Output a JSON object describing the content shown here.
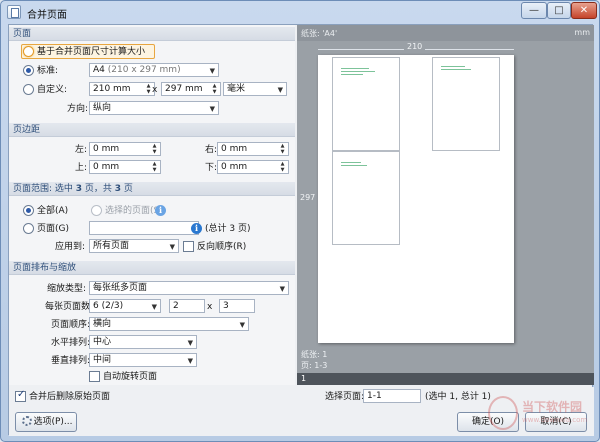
{
  "window": {
    "title": "合并页面",
    "minimize": "—",
    "maximize": "□",
    "close": "✕"
  },
  "page": {
    "section_title": "页面",
    "radio_merge_size": "基于合并页面尺寸计算大小",
    "radio_standard": "标准:",
    "standard_value": "A4",
    "standard_dims": "(210 x 297 mm)",
    "radio_custom": "自定义:",
    "custom_width": "210 mm",
    "custom_x": "x",
    "custom_height": "297 mm",
    "unit": "毫米",
    "orientation_label": "方向:",
    "orientation_value": "纵向"
  },
  "margins": {
    "section_title": "页边距",
    "left_label": "左:",
    "left_value": "0 mm",
    "right_label": "右:",
    "right_value": "0 mm",
    "top_label": "上:",
    "top_value": "0 mm",
    "bottom_label": "下:",
    "bottom_value": "0 mm"
  },
  "range": {
    "section_title_prefix": "页面范围: 选中 ",
    "selected_count": "3",
    "section_title_middle": " 页，共 ",
    "total_count": "3",
    "section_title_suffix": " 页",
    "radio_all": "全部(A)",
    "radio_selected": "选择的页面(S)",
    "radio_pages": "页面(G)",
    "pages_value": "",
    "total_note": "(总计 3 页)",
    "apply_label": "应用到:",
    "apply_value": "所有页面",
    "reverse_label": "反向顺序(R)",
    "info_glyph": "i"
  },
  "layout": {
    "section_title": "页面排布与缩放",
    "scale_type_label": "缩放类型:",
    "scale_type_value": "每张纸多页面",
    "pages_per_sheet_label": "每张页面数:",
    "pages_per_sheet_value": "6 (2/3)",
    "cols_value": "2",
    "times": "x",
    "rows_value": "3",
    "order_label": "页面顺序:",
    "order_value": "横向",
    "h_align_label": "水平排列:",
    "h_align_value": "中心",
    "v_align_label": "垂直排列:",
    "v_align_value": "中间",
    "auto_rotate_label": "自动旋转页面"
  },
  "bottom": {
    "delete_original_label": "合并后删除原始页面",
    "options_button": "选项(P)...",
    "select_pages_label": "选择页面:",
    "select_pages_value": "1-1",
    "select_note": "(选中 1, 总计 1)",
    "ok_button": "确定(O)",
    "cancel_button": "取消(C)"
  },
  "preview": {
    "paper_label": "纸张: 'A4'",
    "unit_label": "mm",
    "width_label": "210",
    "height_label": "297",
    "paper_count": "纸张: 1",
    "page_range": "页: 1-3",
    "page_number": "1"
  },
  "watermark": {
    "brand": "当下软件园",
    "url": "www.downxia.com"
  }
}
